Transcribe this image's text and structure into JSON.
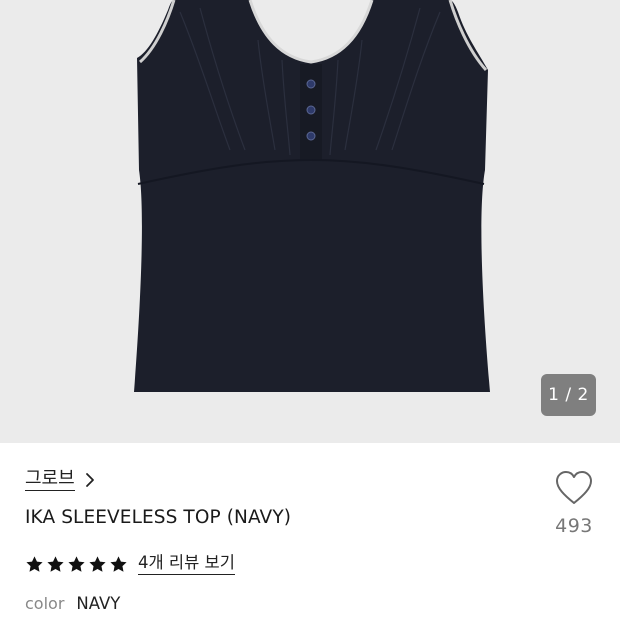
{
  "gallery": {
    "image_alt": "IKA SLEEVELESS TOP (NAVY)",
    "counter": "1 / 2",
    "current_index": 1,
    "total_images": 2
  },
  "product": {
    "brand": "그로브",
    "title": "IKA SLEEVELESS TOP (NAVY)",
    "rating": 5,
    "rating_max": 5,
    "review_link": "4개 리뷰 보기",
    "color_label": "color",
    "color_value": "NAVY"
  },
  "like": {
    "count": "493"
  },
  "icons": {
    "brand_chevron": "chevron-right-icon",
    "star": "star-icon",
    "like": "heart-outline-icon"
  },
  "colors": {
    "garment": "#1c1f2b",
    "background": "#ebebeb",
    "star": "#111111"
  }
}
